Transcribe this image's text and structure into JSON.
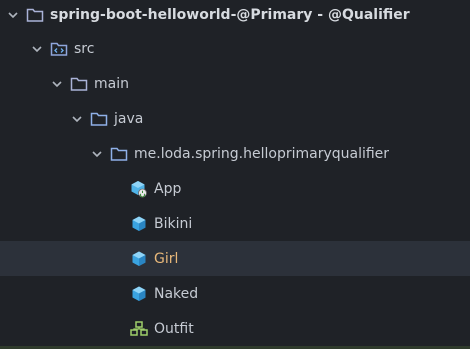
{
  "tree": {
    "root": {
      "label": "spring-boot-helloworld-@Primary - @Qualifier",
      "icon": "folder-icon"
    },
    "src": {
      "label": "src",
      "icon": "source-folder-icon"
    },
    "main": {
      "label": "main",
      "icon": "folder-icon"
    },
    "java": {
      "label": "java",
      "icon": "folder-icon"
    },
    "package": {
      "label": "me.loda.spring.helloprimaryqualifier",
      "icon": "folder-icon"
    },
    "files": [
      {
        "label": "App",
        "icon": "spring-boot-class-icon",
        "selected": false
      },
      {
        "label": "Bikini",
        "icon": "java-class-icon",
        "selected": false
      },
      {
        "label": "Girl",
        "icon": "java-class-icon",
        "selected": true
      },
      {
        "label": "Naked",
        "icon": "java-class-icon",
        "selected": false
      },
      {
        "label": "Outfit",
        "icon": "interface-icon",
        "selected": false
      }
    ]
  },
  "colors": {
    "background": "#1f2227",
    "selected_row": "#2c313a",
    "folder": "#9aa7d6",
    "cube": "#4fb3e8",
    "selected_text": "#e8b87a"
  }
}
